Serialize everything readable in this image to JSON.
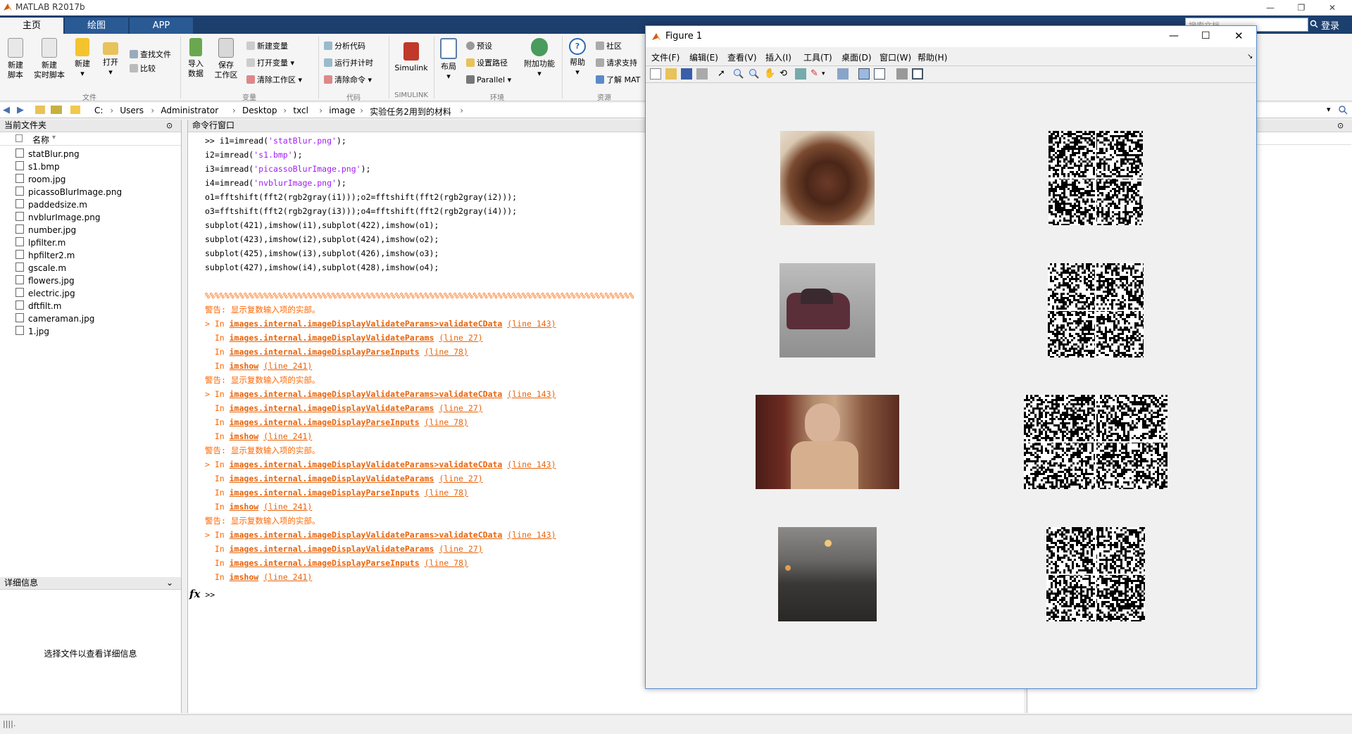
{
  "window": {
    "title": "MATLAB R2017b",
    "controls": [
      "—",
      "❐",
      "✕"
    ]
  },
  "tabs": [
    "主页",
    "绘图",
    "APP"
  ],
  "search": {
    "placeholder": "搜索文档"
  },
  "login_label": "登录",
  "ribbon": {
    "file_group": {
      "label": "文件",
      "new_script": [
        "新建",
        "脚本"
      ],
      "new_live_script": [
        "新建",
        "实时脚本"
      ],
      "new": "新建",
      "open": "打开",
      "find_files": "查找文件",
      "compare": "比较"
    },
    "variable_group": {
      "label": "变量",
      "import": [
        "导入",
        "数据"
      ],
      "save_workspace": [
        "保存",
        "工作区"
      ],
      "new_variable": "新建变量",
      "open_variable": "打开变量",
      "clear_workspace": "清除工作区"
    },
    "code_group": {
      "label": "代码",
      "analyze": "分析代码",
      "run_time": "运行并计时",
      "clear_commands": "清除命令"
    },
    "simulink_group": {
      "label": "SIMULINK",
      "simulink": "Simulink"
    },
    "env_group": {
      "label": "环境",
      "layout": "布局",
      "preferences": "预设",
      "set_path": "设置路径",
      "parallel": "Parallel",
      "addons": "附加功能"
    },
    "resources_group": {
      "label": "资源",
      "help": "帮助",
      "community": "社区",
      "request_support": "请求支持",
      "learn": "了解 MAT"
    }
  },
  "address": {
    "crumbs": [
      "C:",
      "Users",
      "Administrator",
      "Desktop",
      "txcl",
      "image",
      "实验任务2用到的材料"
    ]
  },
  "current_folder": {
    "title": "当前文件夹",
    "column": "名称",
    "files": [
      "statBlur.png",
      "s1.bmp",
      "room.jpg",
      "picassoBlurImage.png",
      "paddedsize.m",
      "nvblurImage.png",
      "number.jpg",
      "lpfilter.m",
      "hpfilter2.m",
      "gscale.m",
      "flowers.jpg",
      "electric.jpg",
      "dftfilt.m",
      "cameraman.jpg",
      "1.jpg"
    ]
  },
  "details": {
    "title": "详细信息",
    "message": "选择文件以查看详细信息"
  },
  "command_window": {
    "title": "命令行窗口",
    "code": [
      [
        ">> i1=imread(",
        "'statBlur.png'",
        ");"
      ],
      [
        "i2=imread(",
        "'s1.bmp'",
        ");"
      ],
      [
        "i3=imread(",
        "'picassoBlurImage.png'",
        ");"
      ],
      [
        "i4=imread(",
        "'nvblurImage.png'",
        ");"
      ]
    ],
    "plain_lines": [
      "o1=fftshift(fft2(rgb2gray(i1)));o2=fftshift(fft2(rgb2gray(i2)));",
      "o3=fftshift(fft2(rgb2gray(i3)));o4=fftshift(fft2(rgb2gray(i4)));",
      "subplot(421),imshow(i1),subplot(422),imshow(o1);",
      "subplot(423),imshow(i2),subplot(424),imshow(o2);",
      "subplot(425),imshow(i3),subplot(426),imshow(o3);",
      "subplot(427),imshow(i4),subplot(428),imshow(o4);"
    ],
    "separator": "%%%%%%%%%%%%%%%%%%%%%%%%%%%%%%%%%%%%%%%%%%%%%%%%%%%%%%%%%%%%%%%%%%%%%%%%%%%%%%%%%%%%%%%%",
    "warning": "警告: 显示复数输入项的实部。",
    "stack": [
      {
        "prefix": "> In ",
        "func": "images.internal.imageDisplayValidateParams>validateCData",
        "line": "(line 143)"
      },
      {
        "prefix": "  In ",
        "func": "images.internal.imageDisplayValidateParams",
        "line": "(line 27)"
      },
      {
        "prefix": "  In ",
        "func": "images.internal.imageDisplayParseInputs",
        "line": "(line 78)"
      },
      {
        "prefix": "  In ",
        "func": "imshow",
        "line": "(line 241)"
      }
    ],
    "prompt": ">>",
    "fx": "fx"
  },
  "figure": {
    "title": "Figure 1",
    "menus": [
      "文件(F)",
      "编辑(E)",
      "查看(V)",
      "插入(I)",
      "工具(T)",
      "桌面(D)",
      "窗口(W)",
      "帮助(H)"
    ]
  },
  "colors": {
    "tab_bar": "#1d3f6e",
    "warning": "#ff6600",
    "string": "#a020f0",
    "figure_border": "#5b8fd1"
  }
}
